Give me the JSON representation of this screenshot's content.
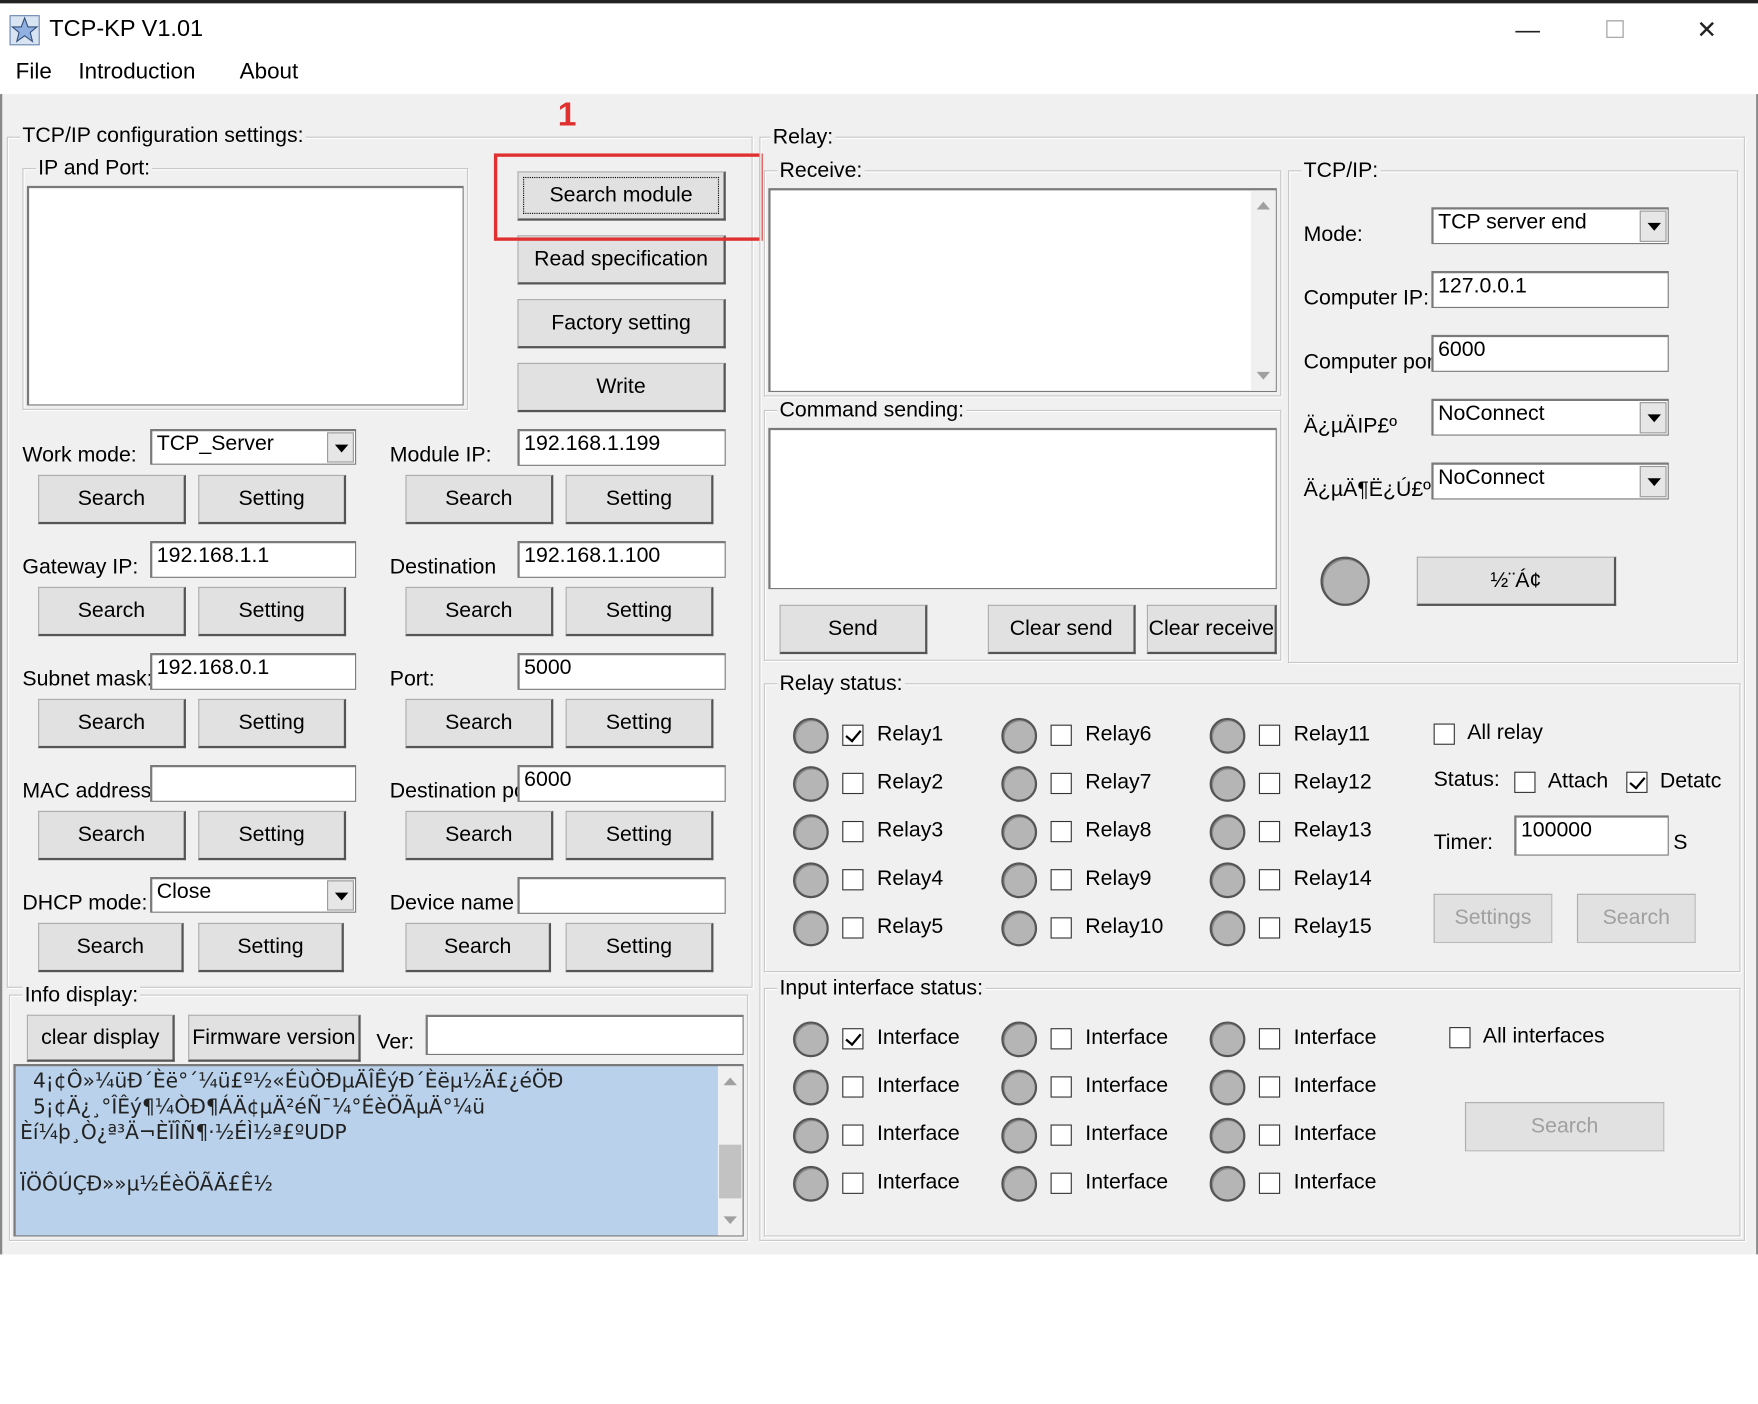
{
  "window": {
    "title": "TCP-KP V1.01",
    "minimize": "—",
    "maximize": "☐",
    "close": "✕"
  },
  "menu": {
    "file": "File",
    "introduction": "Introduction",
    "about": "About"
  },
  "annotation": {
    "number": "1",
    "color": "#e03030"
  },
  "tcpip_config": {
    "group_label": "TCP/IP configuration settings:",
    "ip_port_label": "IP and Port:",
    "search_module": "Search module",
    "read_spec": "Read specification",
    "factory_setting": "Factory setting",
    "write": "Write",
    "search": "Search",
    "setting": "Setting",
    "work_mode_label": "Work mode:",
    "work_mode_value": "TCP_Server",
    "module_ip_label": "Module IP:",
    "module_ip_value": "192.168.1.199",
    "gateway_label": "Gateway IP:",
    "gateway_value": "192.168.1.1",
    "destination_label": "Destination",
    "destination_value": "192.168.1.100",
    "subnet_label": "Subnet mask:",
    "subnet_value": "192.168.0.1",
    "port_label": "Port:",
    "port_value": "5000",
    "mac_label": "MAC address",
    "mac_value": "",
    "dest_port_label": "Destination po",
    "dest_port_value": "6000",
    "dhcp_label": "DHCP mode:",
    "dhcp_value": "Close",
    "device_name_label": "Device name",
    "device_name_value": ""
  },
  "info": {
    "group_label": "Info display:",
    "clear_display": "clear display",
    "firmware_version": "Firmware version",
    "ver_label": "Ver:",
    "ver_value": "",
    "text": "  4¡¢Ô»¼üÐ´Èë°´¼ü£º½«ÉùÒÐµÄÎÊýÐ´Èëµ½Ä£¿éÖÐ\n  5¡¢Ä¿¸°ÎÊý¶¼ÒÐ¶ÁÄ¢µÄ²éÑ¯¼°ÉèÖÃµÄ°¼ü\nÈí¼þ¸Ò¿ª³Ä¬ÈÏÎÑ¶·½ÉÌ½ª£ºUDP\n\nÏÖÔÚÇÐ»»µ½ÉèÖÃÄ£Ê½"
  },
  "relay": {
    "group_label": "Relay:",
    "receive_label": "Receive:",
    "command_label": "Command sending:",
    "send": "Send",
    "clear_send": "Clear send",
    "clear_receive": "Clear receive",
    "tcpip_label": "TCP/IP:",
    "mode_label": "Mode:",
    "mode_value": "TCP server end",
    "computer_ip_label": "Computer IP:",
    "computer_ip_value": "127.0.0.1",
    "computer_port_label": "Computer por",
    "computer_port_value": "6000",
    "target_ip_label": "Ä¿µÄIP£º",
    "target_ip_value": "NoConnect",
    "target_port_label": "Ä¿µÄ¶Ë¿Ú£º",
    "target_port_value": "NoConnect",
    "connect_button": "½¨Á¢"
  },
  "relay_status": {
    "group_label": "Relay status:",
    "relays": [
      {
        "name": "Relay1",
        "checked": true
      },
      {
        "name": "Relay2",
        "checked": false
      },
      {
        "name": "Relay3",
        "checked": false
      },
      {
        "name": "Relay4",
        "checked": false
      },
      {
        "name": "Relay5",
        "checked": false
      },
      {
        "name": "Relay6",
        "checked": false
      },
      {
        "name": "Relay7",
        "checked": false
      },
      {
        "name": "Relay8",
        "checked": false
      },
      {
        "name": "Relay9",
        "checked": false
      },
      {
        "name": "Relay10",
        "checked": false
      },
      {
        "name": "Relay11",
        "checked": false
      },
      {
        "name": "Relay12",
        "checked": false
      },
      {
        "name": "Relay13",
        "checked": false
      },
      {
        "name": "Relay14",
        "checked": false
      },
      {
        "name": "Relay15",
        "checked": false
      }
    ],
    "all_relay": "All relay",
    "status_label": "Status:",
    "attach": "Attach",
    "detach": "Detatc",
    "timer_label": "Timer:",
    "timer_value": "100000",
    "timer_unit": "S",
    "settings": "Settings",
    "search": "Search"
  },
  "input_status": {
    "group_label": "Input interface status:",
    "interface_label": "Interface",
    "interfaces_checked": [
      true,
      false,
      false,
      false,
      false,
      false,
      false,
      false,
      false,
      false,
      false,
      false
    ],
    "all_interfaces": "All interfaces",
    "search": "Search"
  }
}
